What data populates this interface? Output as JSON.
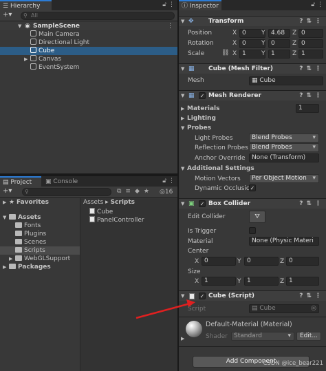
{
  "hierarchy": {
    "tab": "Hierarchy",
    "menu_icons": "⋮",
    "add": "+▾",
    "search_placeholder": "All",
    "scene": "SampleScene",
    "objects": [
      "Main Camera",
      "Directional Light",
      "Cube",
      "Canvas",
      "EventSystem"
    ],
    "selected": "Cube"
  },
  "project": {
    "tabs": [
      "Project",
      "Console"
    ],
    "hidden_count": "16",
    "favorites": "Favorites",
    "assets": "Assets",
    "asset_folders": [
      "Fonts",
      "Plugins",
      "Scenes",
      "Scripts",
      "WebGLSupport"
    ],
    "packages": "Packages",
    "breadcrumb": [
      "Assets",
      "Scripts"
    ],
    "files": [
      "Cube",
      "PanelController"
    ]
  },
  "inspector": {
    "tab": "Inspector",
    "transform": {
      "title": "Transform",
      "rows": [
        {
          "label": "Position",
          "x": "0",
          "y": "4.68",
          "z": "0"
        },
        {
          "label": "Rotation",
          "x": "0",
          "y": "0",
          "z": "0"
        },
        {
          "label": "Scale",
          "x": "1",
          "y": "1",
          "z": "1"
        }
      ]
    },
    "mesh_filter": {
      "title": "Cube (Mesh Filter)",
      "mesh_label": "Mesh",
      "mesh_value": "Cube"
    },
    "mesh_renderer": {
      "title": "Mesh Renderer",
      "materials_label": "Materials",
      "materials_count": "1",
      "lighting": "Lighting",
      "probes": "Probes",
      "light_probes_label": "Light Probes",
      "light_probes_value": "Blend Probes",
      "reflection_probes_label": "Reflection Probes",
      "reflection_probes_value": "Blend Probes",
      "anchor_label": "Anchor Override",
      "anchor_value": "None (Transform)",
      "additional": "Additional Settings",
      "motion_label": "Motion Vectors",
      "motion_value": "Per Object Motion",
      "dynamic_label": "Dynamic Occlusic"
    },
    "box_collider": {
      "title": "Box Collider",
      "edit_label": "Edit Collider",
      "trigger_label": "Is Trigger",
      "material_label": "Material",
      "material_value": "None (Physic Materi",
      "center_label": "Center",
      "center": {
        "x": "0",
        "y": "0",
        "z": "0"
      },
      "size_label": "Size",
      "size": {
        "x": "1",
        "y": "1",
        "z": "1"
      }
    },
    "script": {
      "title": "Cube (Script)",
      "label": "Script",
      "value": "Cube"
    },
    "material": {
      "name": "Default-Material (Material)",
      "shader_label": "Shader",
      "shader_value": "Standard",
      "edit": "Edit..."
    },
    "add_component": "Add Component",
    "watermark": "CSDN @ice_bear221"
  },
  "colors": {
    "selection": "#2c5d87",
    "tab_accent": "#2c7cd6",
    "arrow": "#e02020"
  }
}
